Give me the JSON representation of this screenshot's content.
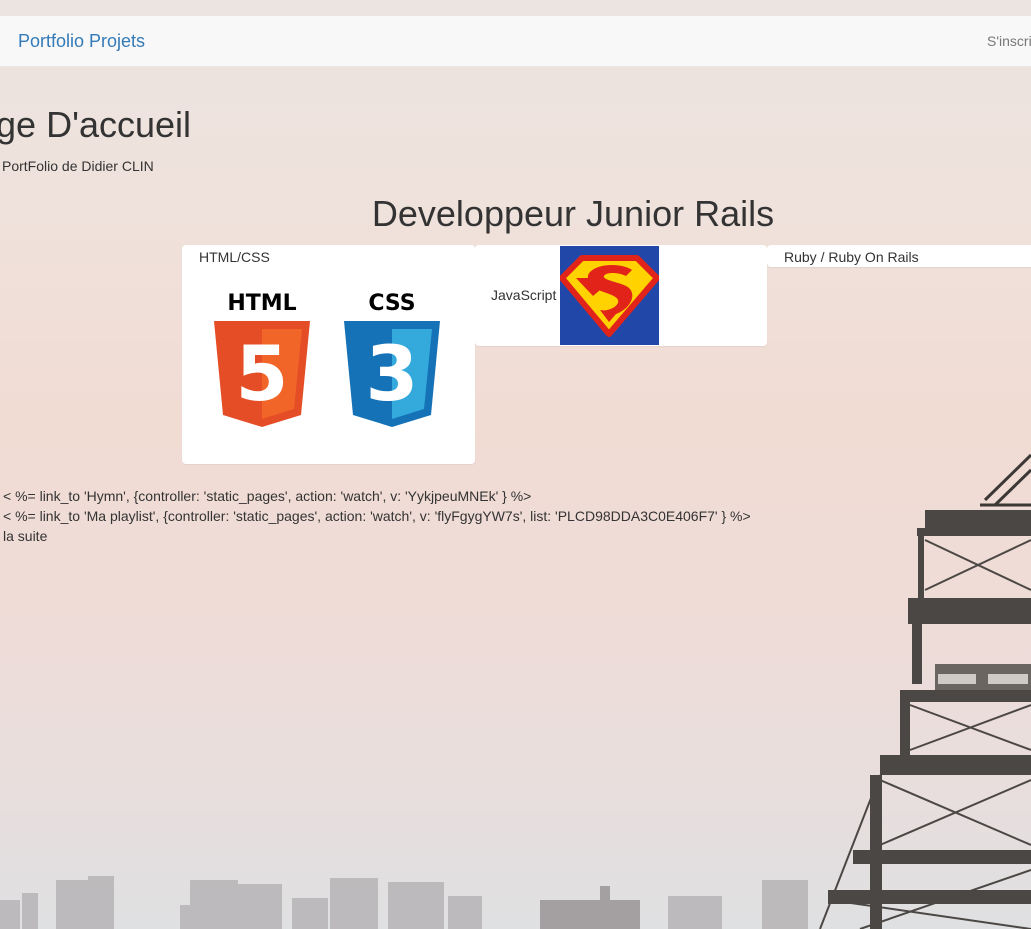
{
  "navbar": {
    "brand": "Portfolio Projets",
    "signup": "S'inscri"
  },
  "header": {
    "title": "age D'accueil",
    "subtitle": "PortFolio de Didier CLIN"
  },
  "section": {
    "title": "Developpeur Junior Rails"
  },
  "panels": [
    {
      "label": "HTML/CSS",
      "logos": [
        {
          "text": "HTML",
          "digit": "5",
          "icon": "html5-logo-icon",
          "color": "#e44d26"
        },
        {
          "text": "CSS",
          "digit": "3",
          "icon": "css3-logo-icon",
          "color": "#1572b6"
        }
      ]
    },
    {
      "label": "JavaScript",
      "icon": "superman-logo-icon"
    },
    {
      "label": "Ruby / Ruby On Rails"
    }
  ],
  "code_lines": [
    "< %= link_to 'Hymn', {controller: 'static_pages', action: 'watch', v: 'YykjpeuMNEk' } %>",
    "< %= link_to 'Ma playlist', {controller: 'static_pages', action: 'watch', v: 'flyFgygYW7s', list: 'PLCD98DDA3C0E406F7' } %>",
    "la suite"
  ],
  "colors": {
    "brand": "#337ab7",
    "navbar_bg": "#f8f8f8",
    "html5": "#e44d26",
    "css3": "#1572b6",
    "superman_bg": "#2148a8",
    "superman_red": "#e2231a",
    "superman_yellow": "#ffd200"
  }
}
